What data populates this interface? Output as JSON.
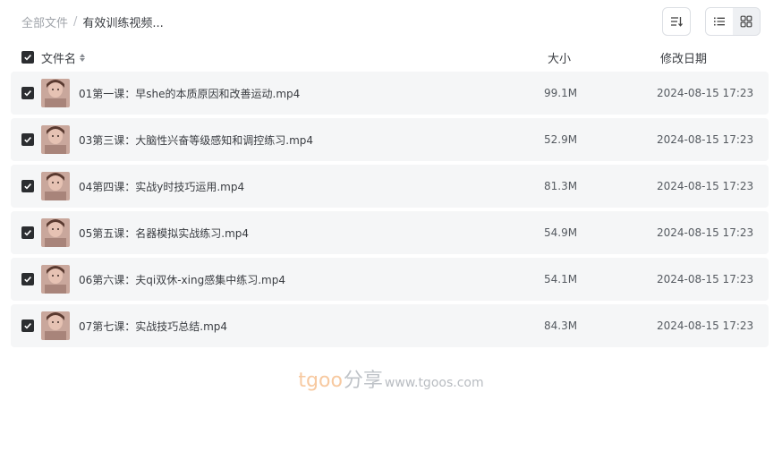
{
  "breadcrumb": {
    "root": "全部文件",
    "separator": "/",
    "current": "有效训练视频..."
  },
  "toolbar": {
    "sort_icon": "sort-list-icon",
    "list_view_icon": "list-view-icon",
    "grid_view_icon": "grid-view-icon"
  },
  "columns": {
    "name": "文件名",
    "size": "大小",
    "date": "修改日期"
  },
  "files": [
    {
      "name": "01第一课：早she的本质原因和改善运动.mp4",
      "size": "99.1M",
      "date": "2024-08-15 17:23",
      "checked": true
    },
    {
      "name": "03第三课：大脑性兴奋等级感知和调控练习.mp4",
      "size": "52.9M",
      "date": "2024-08-15 17:23",
      "checked": true
    },
    {
      "name": "04第四课：实战y时技巧运用.mp4",
      "size": "81.3M",
      "date": "2024-08-15 17:23",
      "checked": true
    },
    {
      "name": "05第五课：名器模拟实战练习.mp4",
      "size": "54.9M",
      "date": "2024-08-15 17:23",
      "checked": true
    },
    {
      "name": "06第六课：夫qi双休-xing感集中练习.mp4",
      "size": "54.1M",
      "date": "2024-08-15 17:23",
      "checked": true
    },
    {
      "name": "07第七课：实战技巧总结.mp4",
      "size": "84.3M",
      "date": "2024-08-15 17:23",
      "checked": true
    }
  ],
  "watermark": {
    "brand": "tgoo",
    "share": "分享",
    "url": "www.tgoos.com"
  },
  "colors": {
    "row_bg": "#f5f6f7",
    "checkbox": "#2b2d30",
    "watermark_brand": "#f7c9a0"
  }
}
